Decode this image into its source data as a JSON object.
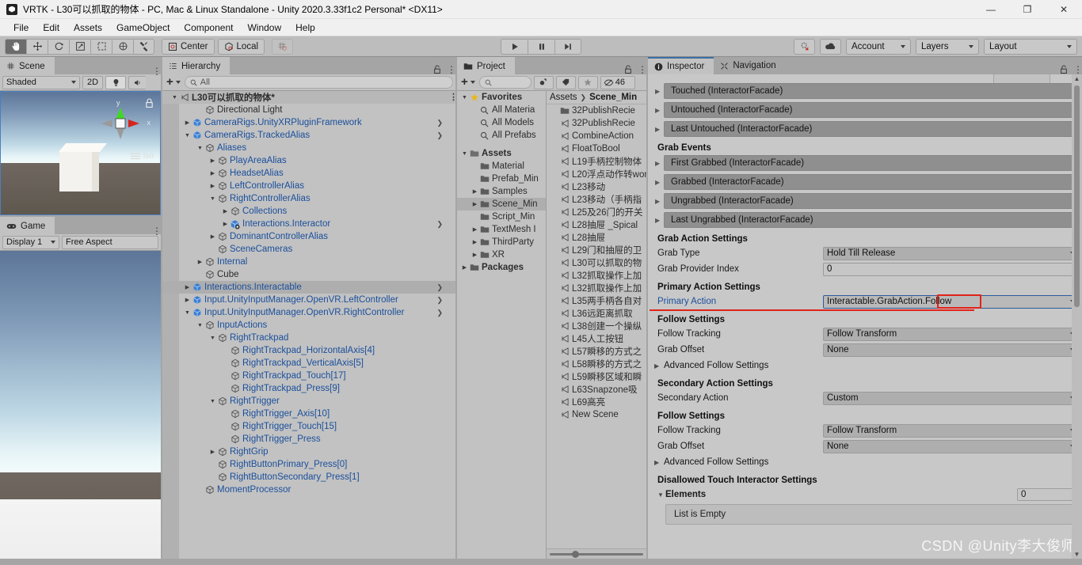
{
  "window": {
    "title": "VRTK - L30可以抓取的物体 - PC, Mac & Linux Standalone - Unity 2020.3.33f1c2 Personal* <DX11>",
    "minimize": "—",
    "maximize": "❐",
    "close": "✕"
  },
  "menu": [
    "File",
    "Edit",
    "Assets",
    "GameObject",
    "Component",
    "Window",
    "Help"
  ],
  "toolbar": {
    "tools": [
      "hand-tool",
      "move-tool",
      "rotate-tool",
      "scale-tool",
      "rect-tool",
      "transform-tool",
      "custom-tool"
    ],
    "pivot_mode": "Center",
    "pivot_space": "Local",
    "grid_snap": "grid-snap",
    "play": "▶",
    "pause": "❚❚",
    "step": "▶❙",
    "collab": "collab-icon",
    "cloud": "cloud-icon",
    "account": "Account",
    "layers": "Layers",
    "layout": "Layout"
  },
  "scene": {
    "tab": "Scene",
    "tab_icon": "grid-icon",
    "shading": "Shaded",
    "mode_2d": "2D",
    "lighting": "lighting-icon",
    "audio": "audio-icon",
    "gizmo_y": "y",
    "gizmo_x": "x",
    "projection": "Iso",
    "lock": "lock-icon"
  },
  "game": {
    "tab": "Game",
    "tab_icon": "gamepad-icon",
    "display": "Display 1",
    "aspect": "Free Aspect"
  },
  "hierarchy": {
    "tab": "Hierarchy",
    "tab_icon": "hierarchy-icon",
    "create_label": "+",
    "search_placeholder": "All",
    "search_value": "",
    "items": [
      {
        "label": "L30可以抓取的物体*",
        "depth": 0,
        "arrow": "▼",
        "icon": "scene-icon",
        "style": "scene",
        "kebab": true
      },
      {
        "label": "Directional Light",
        "depth": 2,
        "arrow": "",
        "icon": "cube",
        "style": "plain"
      },
      {
        "label": "CameraRigs.UnityXRPluginFramework",
        "depth": 1,
        "arrow": "▶",
        "icon": "prefab",
        "style": "blue",
        "chev": true
      },
      {
        "label": "CameraRigs.TrackedAlias",
        "depth": 1,
        "arrow": "▼",
        "icon": "prefab",
        "style": "blue",
        "chev": true
      },
      {
        "label": "Aliases",
        "depth": 2,
        "arrow": "▼",
        "icon": "cube",
        "style": "blue"
      },
      {
        "label": "PlayAreaAlias",
        "depth": 3,
        "arrow": "▶",
        "icon": "cube",
        "style": "blue"
      },
      {
        "label": "HeadsetAlias",
        "depth": 3,
        "arrow": "▶",
        "icon": "cube",
        "style": "blue"
      },
      {
        "label": "LeftControllerAlias",
        "depth": 3,
        "arrow": "▶",
        "icon": "cube",
        "style": "blue"
      },
      {
        "label": "RightControllerAlias",
        "depth": 3,
        "arrow": "▼",
        "icon": "cube",
        "style": "blue"
      },
      {
        "label": "Collections",
        "depth": 4,
        "arrow": "▶",
        "icon": "cube",
        "style": "blue"
      },
      {
        "label": "Interactions.Interactor",
        "depth": 4,
        "arrow": "▶",
        "icon": "prefab-add",
        "style": "blue",
        "chev": true
      },
      {
        "label": "DominantControllerAlias",
        "depth": 3,
        "arrow": "▶",
        "icon": "cube",
        "style": "blue"
      },
      {
        "label": "SceneCameras",
        "depth": 3,
        "arrow": "",
        "icon": "cube",
        "style": "blue"
      },
      {
        "label": "Internal",
        "depth": 2,
        "arrow": "▶",
        "icon": "cube",
        "style": "blue"
      },
      {
        "label": "Cube",
        "depth": 2,
        "arrow": "",
        "icon": "cube",
        "style": "plain"
      },
      {
        "label": "Interactions.Interactable",
        "depth": 1,
        "arrow": "▶",
        "icon": "prefab",
        "style": "blue",
        "chev": true,
        "selected": true
      },
      {
        "label": "Input.UnityInputManager.OpenVR.LeftController",
        "depth": 1,
        "arrow": "▶",
        "icon": "prefab",
        "style": "blue",
        "chev": true
      },
      {
        "label": "Input.UnityInputManager.OpenVR.RightController",
        "depth": 1,
        "arrow": "▼",
        "icon": "prefab",
        "style": "blue",
        "chev": true
      },
      {
        "label": "InputActions",
        "depth": 2,
        "arrow": "▼",
        "icon": "cube",
        "style": "blue"
      },
      {
        "label": "RightTrackpad",
        "depth": 3,
        "arrow": "▼",
        "icon": "cube",
        "style": "blue"
      },
      {
        "label": "RightTrackpad_HorizontalAxis[4]",
        "depth": 4,
        "arrow": "",
        "icon": "cube",
        "style": "blue"
      },
      {
        "label": "RightTrackpad_VerticalAxis[5]",
        "depth": 4,
        "arrow": "",
        "icon": "cube",
        "style": "blue"
      },
      {
        "label": "RightTrackpad_Touch[17]",
        "depth": 4,
        "arrow": "",
        "icon": "cube",
        "style": "blue"
      },
      {
        "label": "RightTrackpad_Press[9]",
        "depth": 4,
        "arrow": "",
        "icon": "cube",
        "style": "blue"
      },
      {
        "label": "RightTrigger",
        "depth": 3,
        "arrow": "▼",
        "icon": "cube",
        "style": "blue"
      },
      {
        "label": "RightTrigger_Axis[10]",
        "depth": 4,
        "arrow": "",
        "icon": "cube",
        "style": "blue"
      },
      {
        "label": "RightTrigger_Touch[15]",
        "depth": 4,
        "arrow": "",
        "icon": "cube",
        "style": "blue"
      },
      {
        "label": "RightTrigger_Press",
        "depth": 4,
        "arrow": "",
        "icon": "cube",
        "style": "blue"
      },
      {
        "label": "RightGrip",
        "depth": 3,
        "arrow": "▶",
        "icon": "cube",
        "style": "blue"
      },
      {
        "label": "RightButtonPrimary_Press[0]",
        "depth": 3,
        "arrow": "",
        "icon": "cube",
        "style": "blue"
      },
      {
        "label": "RightButtonSecondary_Press[1]",
        "depth": 3,
        "arrow": "",
        "icon": "cube",
        "style": "blue"
      },
      {
        "label": "MomentProcessor",
        "depth": 2,
        "arrow": "",
        "icon": "cube",
        "style": "blue"
      }
    ]
  },
  "project": {
    "tab": "Project",
    "tab_icon": "folder-icon",
    "create_label": "+",
    "search_placeholder": "",
    "filter_icons": [
      "asset-type-icon",
      "label-icon",
      "star-icon"
    ],
    "hidden_count": "46",
    "breadcrumb": [
      "Assets",
      "Scene_Min"
    ],
    "tree": [
      {
        "label": "Favorites",
        "depth": 0,
        "arrow": "▼",
        "icon": "star",
        "bold": true
      },
      {
        "label": "All Materia",
        "depth": 1,
        "arrow": "",
        "icon": "search"
      },
      {
        "label": "All Models",
        "depth": 1,
        "arrow": "",
        "icon": "search"
      },
      {
        "label": "All Prefabs",
        "depth": 1,
        "arrow": "",
        "icon": "search"
      },
      {
        "label": "",
        "depth": 0,
        "arrow": "",
        "icon": "none"
      },
      {
        "label": "Assets",
        "depth": 0,
        "arrow": "▼",
        "icon": "folder-open",
        "bold": true
      },
      {
        "label": "Material",
        "depth": 1,
        "arrow": "",
        "icon": "folder"
      },
      {
        "label": "Prefab_Min",
        "depth": 1,
        "arrow": "",
        "icon": "folder"
      },
      {
        "label": "Samples",
        "depth": 1,
        "arrow": "▶",
        "icon": "folder"
      },
      {
        "label": "Scene_Min",
        "depth": 1,
        "arrow": "▶",
        "icon": "folder",
        "selected": true
      },
      {
        "label": "Script_Min",
        "depth": 1,
        "arrow": "",
        "icon": "folder"
      },
      {
        "label": "TextMesh I",
        "depth": 1,
        "arrow": "▶",
        "icon": "folder"
      },
      {
        "label": "ThirdParty",
        "depth": 1,
        "arrow": "▶",
        "icon": "folder"
      },
      {
        "label": "XR",
        "depth": 1,
        "arrow": "▶",
        "icon": "folder"
      },
      {
        "label": "Packages",
        "depth": 0,
        "arrow": "▶",
        "icon": "folder",
        "bold": true
      }
    ],
    "assets": [
      {
        "label": "32PublishRecie",
        "icon": "folder"
      },
      {
        "label": "32PublishRecie",
        "icon": "scene"
      },
      {
        "label": "CombineAction",
        "icon": "scene"
      },
      {
        "label": "FloatToBool",
        "icon": "scene"
      },
      {
        "label": "L19手柄控制物体",
        "icon": "scene"
      },
      {
        "label": "L20浮点动作转won",
        "icon": "scene"
      },
      {
        "label": "L23移动",
        "icon": "scene"
      },
      {
        "label": "L23移动（手柄指",
        "icon": "scene"
      },
      {
        "label": "L25及26门的开关",
        "icon": "scene"
      },
      {
        "label": "L28抽屉 _Spical",
        "icon": "scene"
      },
      {
        "label": "L28抽屉",
        "icon": "scene"
      },
      {
        "label": "L29门和抽屉的卫",
        "icon": "scene"
      },
      {
        "label": "L30可以抓取的物",
        "icon": "scene"
      },
      {
        "label": "L32抓取操作上加",
        "icon": "scene"
      },
      {
        "label": "L32抓取操作上加",
        "icon": "scene"
      },
      {
        "label": "L35两手柄各自对",
        "icon": "scene"
      },
      {
        "label": "L36远距离抓取",
        "icon": "scene"
      },
      {
        "label": "L38创建一个操纵",
        "icon": "scene"
      },
      {
        "label": "L45人工按钮",
        "icon": "scene"
      },
      {
        "label": "L57瞬移的方式之",
        "icon": "scene"
      },
      {
        "label": "L58瞬移的方式之",
        "icon": "scene"
      },
      {
        "label": "L59瞬移区域和瞬",
        "icon": "scene"
      },
      {
        "label": "L63Snapzone吸",
        "icon": "scene"
      },
      {
        "label": "L69高亮",
        "icon": "scene"
      },
      {
        "label": "New Scene",
        "icon": "scene"
      }
    ]
  },
  "inspector": {
    "tab": "Inspector",
    "tab_icon": "info-icon",
    "tab2": "Navigation",
    "tab2_icon": "navmesh-icon",
    "events_top": [
      "Touched (InteractorFacade)",
      "Untouched (InteractorFacade)",
      "Last Untouched (InteractorFacade)"
    ],
    "grab_events_header": "Grab Events",
    "grab_events": [
      "First Grabbed (InteractorFacade)",
      "Grabbed (InteractorFacade)",
      "Ungrabbed (InteractorFacade)",
      "Last Ungrabbed (InteractorFacade)"
    ],
    "grab_action_header": "Grab Action Settings",
    "grab_type_label": "Grab Type",
    "grab_type_value": "Hold Till Release",
    "grab_provider_label": "Grab Provider Index",
    "grab_provider_value": "0",
    "primary_header": "Primary Action Settings",
    "primary_label": "Primary Action",
    "primary_value_prefix": "Interactable.GrabAction.",
    "primary_value_highlight": "Follow",
    "follow_header_1": "Follow Settings",
    "follow_tracking_label_1": "Follow Tracking",
    "follow_tracking_value_1": "Follow Transform",
    "grab_offset_label_1": "Grab Offset",
    "grab_offset_value_1": "None",
    "advanced_follow_1": "Advanced Follow Settings",
    "secondary_header": "Secondary Action Settings",
    "secondary_label": "Secondary Action",
    "secondary_value": "Custom",
    "follow_header_2": "Follow Settings",
    "follow_tracking_label_2": "Follow Tracking",
    "follow_tracking_value_2": "Follow Transform",
    "grab_offset_label_2": "Grab Offset",
    "grab_offset_value_2": "None",
    "advanced_follow_2": "Advanced Follow Settings",
    "disallowed_header": "Disallowed Touch Interactor Settings",
    "elements_label": "Elements",
    "elements_count": "0",
    "list_empty": "List is Empty"
  },
  "watermark": "CSDN @Unity李大俊师",
  "colors": {
    "accent_blue": "#3d6ea5",
    "annotation_red": "#e2231a",
    "link_blue": "#1a4f9c",
    "panel_bg": "#c2c2c2",
    "inspector_bg": "#c8c8c8"
  }
}
